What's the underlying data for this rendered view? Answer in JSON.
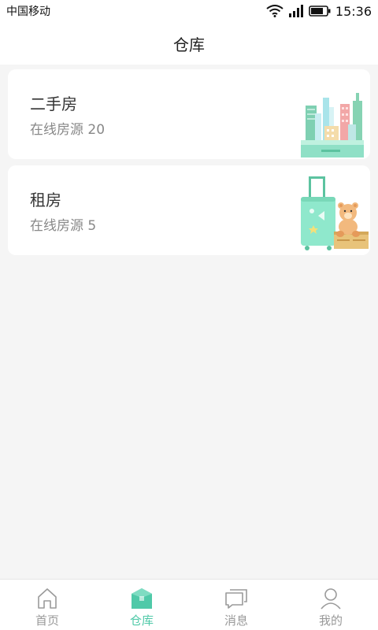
{
  "status": {
    "carrier": "中国移动",
    "time": "15:36",
    "icons": [
      "wifi-icon",
      "signal-icon",
      "battery-icon"
    ]
  },
  "header": {
    "title": "仓库"
  },
  "cards": [
    {
      "title": "二手房",
      "subtitle": "在线房源 20",
      "illustration": "city-buildings-illustration"
    },
    {
      "title": "租房",
      "subtitle": "在线房源 5",
      "illustration": "suitcase-teddy-illustration"
    }
  ],
  "tabbar": {
    "items": [
      {
        "label": "首页",
        "icon": "home-icon",
        "active": false
      },
      {
        "label": "仓库",
        "icon": "warehouse-box-icon",
        "active": true
      },
      {
        "label": "消息",
        "icon": "message-icon",
        "active": false
      },
      {
        "label": "我的",
        "icon": "user-icon",
        "active": false
      }
    ]
  },
  "colors": {
    "accent": "#4fc9a8",
    "background": "#f5f5f5",
    "card": "#ffffff",
    "title_text": "#333333",
    "sub_text": "#888888"
  }
}
